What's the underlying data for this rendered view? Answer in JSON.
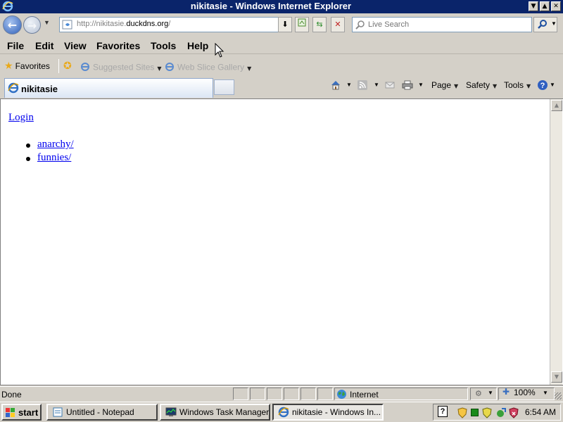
{
  "window": {
    "title": "nikitasie - Windows Internet Explorer",
    "minimize_glyph": "▼",
    "maximize_glyph": "▲",
    "close_glyph": "✕"
  },
  "navigation": {
    "back_glyph": "←",
    "forward_glyph": "→",
    "address_prefix": "http://nikitasie.",
    "address_domain": "duckdns.org",
    "address_suffix": "/",
    "search_placeholder": "Live Search"
  },
  "menu": [
    "File",
    "Edit",
    "View",
    "Favorites",
    "Tools",
    "Help"
  ],
  "favorites_bar": {
    "favorites_label": "Favorites",
    "star_glyph": "★",
    "links": [
      "Suggested Sites",
      "Web Slice Gallery"
    ]
  },
  "tabs": {
    "active_title": "nikitasie"
  },
  "command_bar": {
    "page_label": "Page",
    "safety_label": "Safety",
    "tools_label": "Tools"
  },
  "page": {
    "login_link": "Login",
    "links": [
      "anarchy/",
      "funnies/"
    ]
  },
  "status": {
    "text": "Done",
    "zone": "Internet",
    "zoom": "100%"
  },
  "taskbar": {
    "start_label": "start",
    "tasks": [
      "Untitled - Notepad",
      "Windows Task Manager",
      "nikitasie - Windows In..."
    ],
    "clock": "6:54 AM"
  },
  "colors": {
    "titlebar": "#0a246a",
    "link": "#0000ee",
    "chrome": "#d4d0c8"
  }
}
